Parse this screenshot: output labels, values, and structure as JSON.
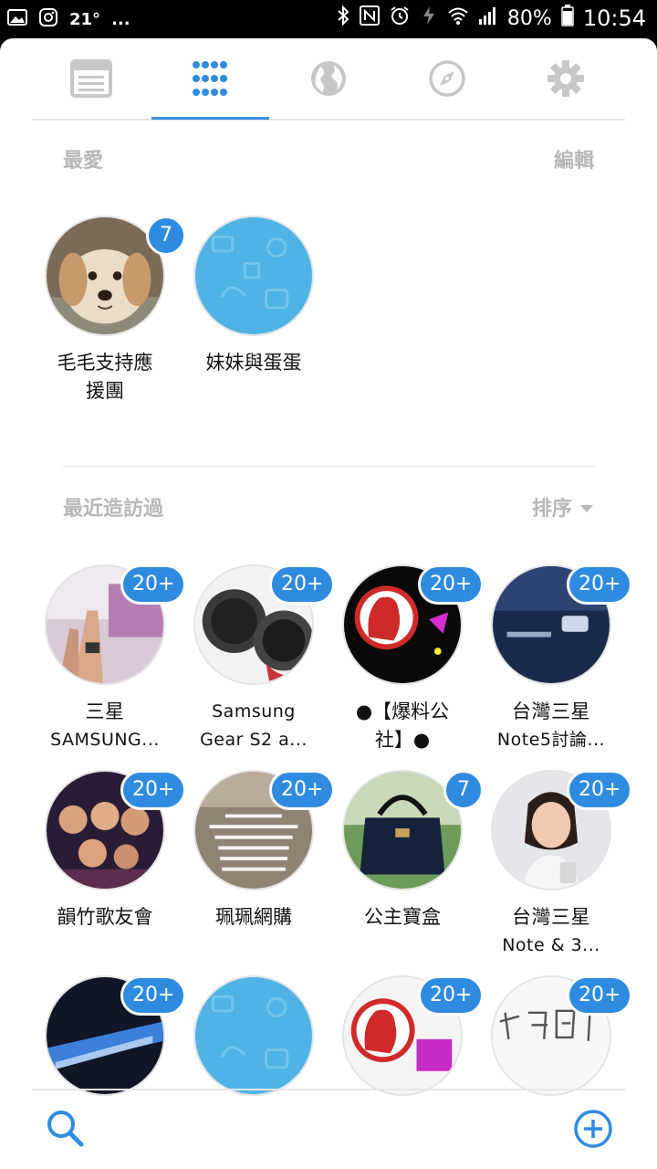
{
  "status_bar": {
    "temperature": "21°",
    "more": "...",
    "battery_percent": "80%",
    "time": "10:54"
  },
  "tabs": [
    {
      "name": "browser-icon",
      "selected": false
    },
    {
      "name": "apps-grid-icon",
      "selected": true
    },
    {
      "name": "globe-icon",
      "selected": false
    },
    {
      "name": "compass-icon",
      "selected": false
    },
    {
      "name": "gear-icon",
      "selected": false
    }
  ],
  "favorites": {
    "title": "最愛",
    "edit_label": "編輯",
    "items": [
      {
        "line1": "毛毛支持應",
        "line2": "援團",
        "badge": "7"
      },
      {
        "line1": "妹妹與蛋蛋",
        "line2": "",
        "badge": ""
      }
    ]
  },
  "recent": {
    "title": "最近造訪過",
    "sort_label": "排序",
    "items": [
      {
        "line1": "三星",
        "line2": "SAMSUNG...",
        "badge": "20+"
      },
      {
        "line1": "Samsung",
        "line2": "Gear S2 a...",
        "badge": "20+"
      },
      {
        "line1": "●【爆料公",
        "line2": "社】●",
        "badge": "20+"
      },
      {
        "line1": "台灣三星",
        "line2": "Note5討論...",
        "badge": "20+"
      },
      {
        "line1": "韻竹歌友會",
        "line2": "",
        "badge": "20+"
      },
      {
        "line1": "珮珮網購",
        "line2": "",
        "badge": "20+"
      },
      {
        "line1": "公主寶盒",
        "line2": "",
        "badge": "7"
      },
      {
        "line1": "台灣三星",
        "line2": "Note & 3...",
        "badge": "20+"
      },
      {
        "line1": "",
        "line2": "",
        "badge": "20+"
      },
      {
        "line1": "",
        "line2": "",
        "badge": ""
      },
      {
        "line1": "",
        "line2": "",
        "badge": "20+"
      },
      {
        "line1": "",
        "line2": "",
        "badge": "20+"
      }
    ]
  },
  "colors": {
    "accent": "#2f8be0",
    "section_label": "#b7b7b7",
    "default_avatar": "#4fb3e6"
  }
}
